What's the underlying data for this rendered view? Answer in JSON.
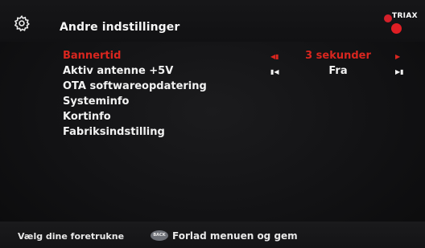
{
  "header": {
    "title": "Andre indstillinger",
    "settings_icon": "gear-icon",
    "logo_text": "TRIAX"
  },
  "menu": {
    "items": [
      {
        "label": "Bannertid",
        "value": "3 sekunder",
        "selected": true
      },
      {
        "label": "Aktiv antenne +5V",
        "value": "Fra",
        "selected": false
      },
      {
        "label": "OTA softwareopdatering"
      },
      {
        "label": "Systeminfo"
      },
      {
        "label": "Kortinfo"
      },
      {
        "label": "Fabriksindstilling"
      }
    ]
  },
  "footer": {
    "hint": "Vælg dine foretrukne",
    "back_button": "BACK",
    "back_hint": "Forlad menuen og gem"
  },
  "colors": {
    "highlight": "#d9261f",
    "text": "#f2f2f2",
    "background": "#121214",
    "brand_red": "#e01e24"
  }
}
